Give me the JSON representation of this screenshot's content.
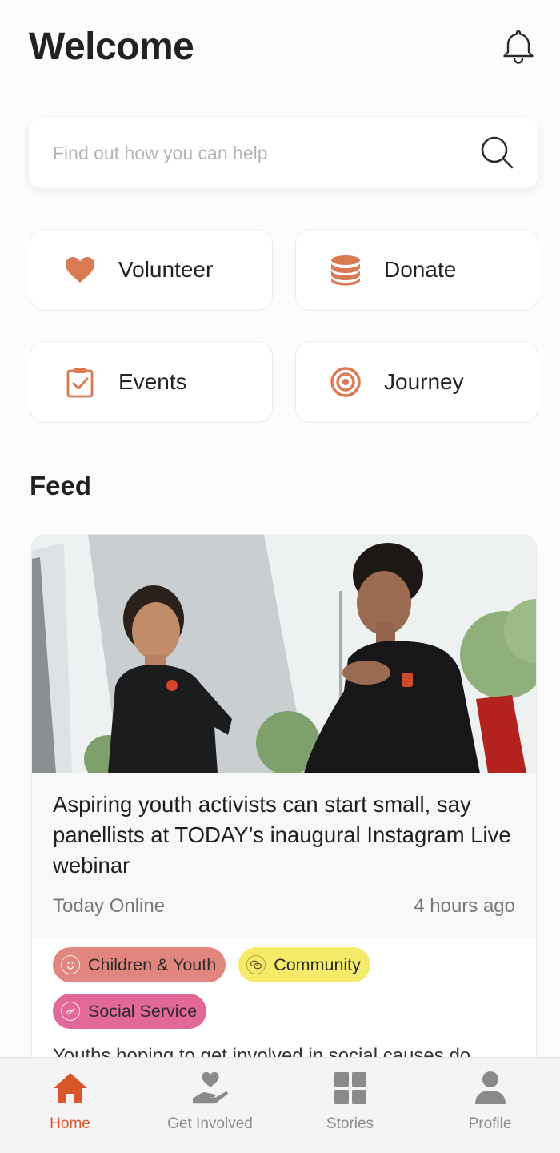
{
  "header": {
    "title": "Welcome",
    "bell_icon": "bell-icon"
  },
  "search": {
    "placeholder": "Find out how you can help",
    "value": "",
    "icon": "search-icon"
  },
  "actions": [
    {
      "label": "Volunteer",
      "icon": "heart-icon"
    },
    {
      "label": "Donate",
      "icon": "coin-stack-icon"
    },
    {
      "label": "Events",
      "icon": "clipboard-check-icon"
    },
    {
      "label": "Journey",
      "icon": "target-icon"
    }
  ],
  "feed": {
    "title": "Feed",
    "card": {
      "headline": "Aspiring youth activists can start small, say panellists at TODAY’s inaugural Instagram Live webinar",
      "source": "Today Online",
      "time": "4 hours ago",
      "tags": [
        {
          "label": "Children & Youth",
          "color": "#e0867f",
          "icon": "smiley-icon"
        },
        {
          "label": "Community",
          "color": "#f6ea6a",
          "icon": "chat-icon"
        },
        {
          "label": "Social Service",
          "color": "#e26897",
          "icon": "handshake-icon"
        }
      ],
      "snippet": "Youths hoping to get involved in social causes do"
    }
  },
  "bottom_nav": [
    {
      "label": "Home",
      "icon": "home-icon",
      "active": true
    },
    {
      "label": "Get Involved",
      "icon": "heart-hand-icon",
      "active": false
    },
    {
      "label": "Stories",
      "icon": "grid-icon",
      "active": false
    },
    {
      "label": "Profile",
      "icon": "person-icon",
      "active": false
    }
  ],
  "colors": {
    "accent": "#d9562a",
    "tile_icon": "#d97a52"
  }
}
